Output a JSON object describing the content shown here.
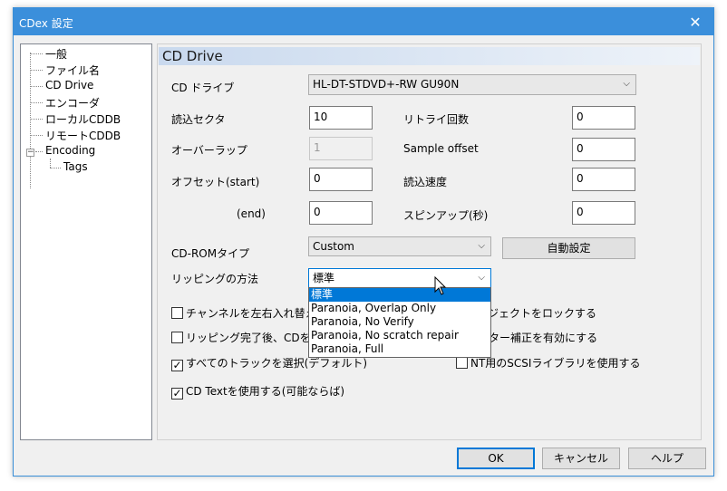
{
  "window": {
    "title": "CDex 設定"
  },
  "tree": {
    "items": [
      {
        "label": "一般"
      },
      {
        "label": "ファイル名"
      },
      {
        "label": "CD Drive"
      },
      {
        "label": "エンコーダ"
      },
      {
        "label": "ローカルCDDB"
      },
      {
        "label": "リモートCDDB"
      },
      {
        "label": "Encoding"
      },
      {
        "label": "Tags"
      }
    ]
  },
  "panel": {
    "header": "CD Drive",
    "cd_drive_label": "CD ドライブ",
    "cd_drive_value": "HL-DT-STDVD+-RW GU90N",
    "read_sector_label": "読込セクタ",
    "read_sector_value": "10",
    "retry_label": "リトライ回数",
    "retry_value": "0",
    "overlap_label": "オーバーラップ",
    "overlap_value": "1",
    "sample_offset_label": "Sample offset",
    "sample_offset_value": "0",
    "offset_start_label": "オフセット(start)",
    "offset_start_value": "0",
    "read_speed_label": "読込速度",
    "read_speed_value": "0",
    "offset_end_label": "(end)",
    "offset_end_value": "0",
    "spinup_label": "スピンアップ(秒)",
    "spinup_value": "0",
    "cdrom_type_label": "CD-ROMタイプ",
    "cdrom_type_value": "Custom",
    "auto_setting_button": "自動設定",
    "ripping_method_label": "リッピングの方法",
    "ripping_method_value": "標準",
    "ripping_method_options": [
      "標準",
      "Paranoia, Overlap Only",
      "Paranoia, No Verify",
      "Paranoia, No scratch repair",
      "Paranoia, Full"
    ],
    "checkboxes": {
      "swap_channels": {
        "label": "チャンネルを左右入れ替える",
        "checked": false
      },
      "lock_eject": {
        "label": "ジェクトをロックする",
        "checked": false
      },
      "eject_after": {
        "label": "リッピング完了後、CDをイジェ",
        "checked": false
      },
      "jitter_fix": {
        "label": "ター補正を有効にする",
        "checked": false
      },
      "select_all_tracks": {
        "label": "すべてのトラックを選択(デフォルト)",
        "checked": true
      },
      "nt_scsi": {
        "label": "NT用のSCSIライブラリを使用する",
        "checked": false
      },
      "cd_text": {
        "label": "CD Textを使用する(可能ならば)",
        "checked": true
      }
    }
  },
  "buttons": {
    "ok": "OK",
    "cancel": "キャンセル",
    "help": "ヘルプ"
  },
  "colors": {
    "titlebar": "#3b8fdb",
    "selection": "#0078d7"
  }
}
